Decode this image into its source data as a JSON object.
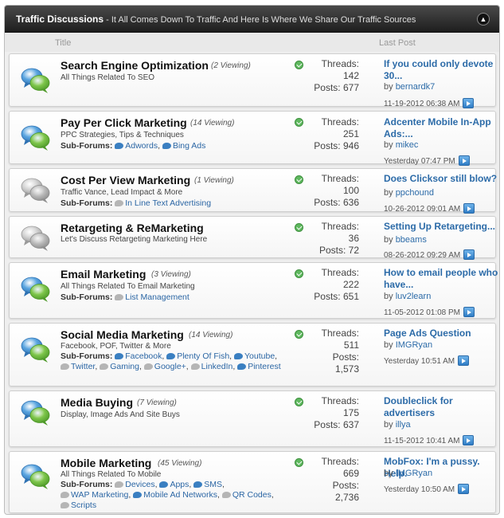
{
  "header": {
    "title": "Traffic Discussions",
    "subtitle": " - It All Comes Down To Traffic And Here Is Where We Share Our Traffic Sources",
    "collapse_icon": "collapse-up-icon"
  },
  "columns": {
    "title": "Title",
    "last_post": "Last Post"
  },
  "labels": {
    "threads": "Threads:",
    "posts": "Posts:",
    "by": "by",
    "subforums": "Sub-Forums:"
  },
  "forums": [
    {
      "title": "Search Engine Optimization",
      "viewing": "(2 Viewing)",
      "description": "All Things Related To SEO",
      "threads": "142",
      "posts": "677",
      "icon": "bubbles-icon",
      "active": true,
      "last_post": {
        "title": "If you could only devote 30...",
        "user": "bernardk7",
        "date": "11-19-2012",
        "time": "06:38 AM"
      }
    },
    {
      "title": "Pay Per Click Marketing",
      "viewing": "(14 Viewing)",
      "description": "PPC Strategies, Tips & Techniques",
      "subforums": [
        {
          "label": "Adwords",
          "active": true
        },
        {
          "label": "Bing Ads",
          "active": true
        }
      ],
      "threads": "251",
      "posts": "946",
      "icon": "bubbles-icon",
      "active": true,
      "last_post": {
        "title": "Adcenter Mobile In-App Ads:...",
        "user": "mikec",
        "date": "Yesterday",
        "time": "07:47 PM"
      }
    },
    {
      "title": "Cost Per View Marketing",
      "viewing": "(1 Viewing)",
      "description": "Traffic Vance, Lead Impact & More",
      "subforums": [
        {
          "label": "In Line Text Advertising",
          "active": false
        }
      ],
      "threads": "100",
      "posts": "636",
      "icon": "bubbles-icon",
      "active": false,
      "last_post": {
        "title": "Does Clicksor still blow?",
        "user": "ppchound",
        "date": "10-26-2012",
        "time": "09:01 AM"
      }
    },
    {
      "title": "Retargeting & ReMarketing",
      "viewing": "",
      "description": "Let's Discuss Retargeting Marketing Here",
      "threads": "36",
      "posts": "72",
      "icon": "bubbles-icon",
      "active": false,
      "last_post": {
        "title": "Setting Up Retargeting...",
        "user": "bbeams",
        "date": "08-26-2012",
        "time": "09:29 AM"
      }
    },
    {
      "title": "Email Marketing",
      "viewing": "(3 Viewing)",
      "description": "All Things Related To Email Marketing",
      "subforums": [
        {
          "label": "List Management",
          "active": false
        }
      ],
      "threads": "222",
      "posts": "651",
      "icon": "bubbles-icon",
      "active": true,
      "last_post": {
        "title": "How to email people who have...",
        "user": "luv2learn",
        "date": "11-05-2012",
        "time": "01:08 PM"
      }
    },
    {
      "title": "Social Media Marketing",
      "viewing": "(14 Viewing)",
      "description": "Facebook, POF, Twitter & More",
      "subforums": [
        {
          "label": "Facebook",
          "active": true
        },
        {
          "label": "Plenty Of Fish",
          "active": true
        },
        {
          "label": "Youtube",
          "active": true
        },
        {
          "label": "Twitter",
          "active": false
        },
        {
          "label": "Gaming",
          "active": false
        },
        {
          "label": "Google+",
          "active": false
        },
        {
          "label": "LinkedIn",
          "active": false
        },
        {
          "label": "Pinterest",
          "active": true
        }
      ],
      "threads": "511",
      "posts": "1,573",
      "icon": "bubbles-icon",
      "active": true,
      "last_post": {
        "title": "Page Ads Question",
        "user": "IMGRyan",
        "date": "Yesterday",
        "time": "10:51 AM"
      }
    },
    {
      "title": "Media Buying",
      "viewing": "(7 Viewing)",
      "description": "Display, Image Ads And Site Buys",
      "threads": "175",
      "posts": "637",
      "icon": "bubbles-icon",
      "active": true,
      "last_post": {
        "title": "Doubleclick for advertisers",
        "user": "illya",
        "date": "11-15-2012",
        "time": "10:41 AM"
      }
    },
    {
      "title": "Mobile Marketing",
      "viewing": "(45 Viewing)",
      "description": "All Things Related To Mobile",
      "subforums": [
        {
          "label": "Devices",
          "active": false
        },
        {
          "label": "Apps",
          "active": true
        },
        {
          "label": "SMS",
          "active": true
        },
        {
          "label": "WAP Marketing",
          "active": false
        },
        {
          "label": "Mobile Ad Networks",
          "active": true
        },
        {
          "label": "QR Codes",
          "active": false
        },
        {
          "label": "Scripts",
          "active": false
        }
      ],
      "threads": "669",
      "posts": "2,736",
      "icon": "bubbles-icon",
      "active": true,
      "last_post": {
        "title": "MobFox: I'm a pussy. Help.",
        "user": "IMGRyan",
        "date": "Yesterday",
        "time": "10:50 AM"
      }
    }
  ]
}
